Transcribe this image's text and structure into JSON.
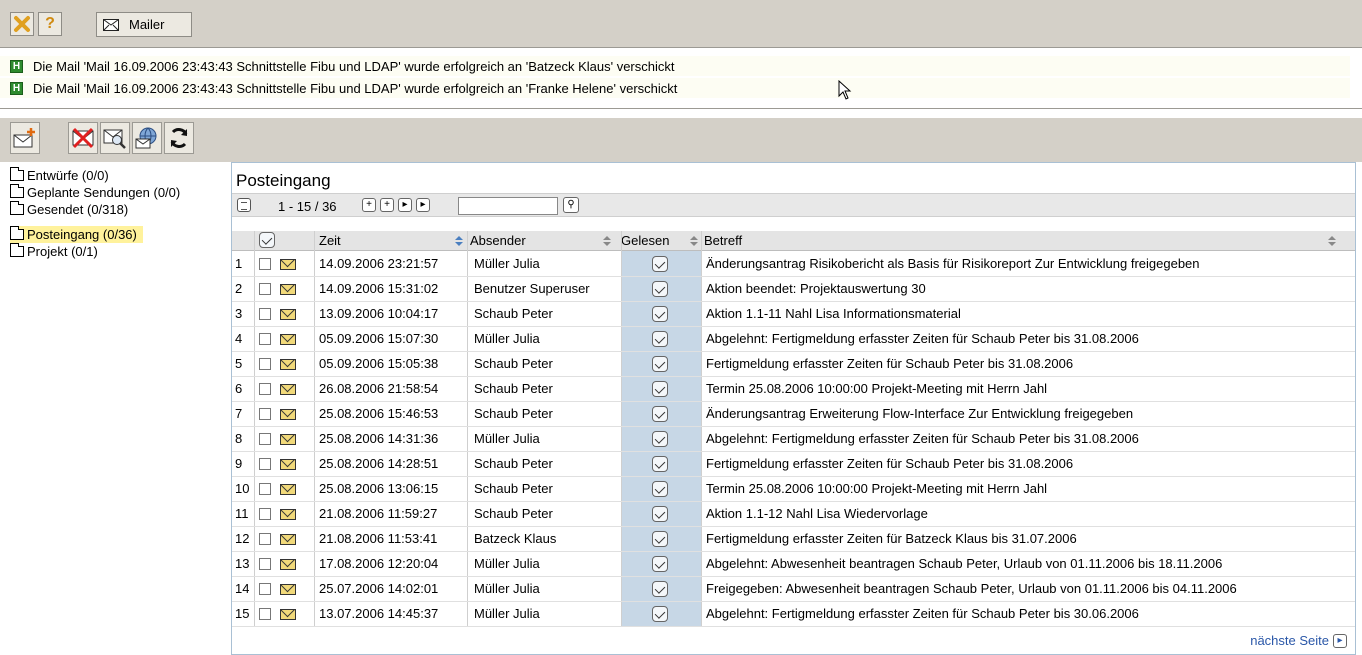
{
  "toolbar": {
    "mailer_label": "Mailer",
    "close_icon": "close-icon",
    "help_icon": "help-icon",
    "mail_icon": "envelope-icon",
    "help_glyph": "?"
  },
  "messages": [
    {
      "icon": "H",
      "text": "Die Mail 'Mail 16.09.2006 23:43:43 Schnittstelle Fibu und LDAP' wurde erfolgreich an 'Batzeck Klaus' verschickt"
    },
    {
      "icon": "H",
      "text": "Die Mail 'Mail 16.09.2006 23:43:43 Schnittstelle Fibu und LDAP' wurde erfolgreich an 'Franke Helene' verschickt"
    }
  ],
  "sidebar": {
    "folders": [
      {
        "label": "Entwürfe (0/0)",
        "selected": false
      },
      {
        "label": "Geplante Sendungen (0/0)",
        "selected": false
      },
      {
        "label": "Gesendet (0/318)",
        "selected": false
      },
      {
        "label": "Posteingang (0/36)",
        "selected": true
      },
      {
        "label": "Projekt (0/1)",
        "selected": false
      }
    ]
  },
  "main": {
    "title": "Posteingang",
    "pager": {
      "range": "1 - 15 / 36",
      "search_value": ""
    },
    "columns": {
      "time": "Zeit",
      "sender": "Absender",
      "read": "Gelesen",
      "subject": "Betreff"
    },
    "next_label": "nächste Seite",
    "rows": [
      {
        "n": "1",
        "time": "14.09.2006 23:21:57",
        "sender": "Müller Julia",
        "subject": "Änderungsantrag Risikobericht als Basis für Risikoreport Zur Entwicklung freigegeben"
      },
      {
        "n": "2",
        "time": "14.09.2006 15:31:02",
        "sender": "Benutzer Superuser",
        "subject": "Aktion beendet: Projektauswertung 30"
      },
      {
        "n": "3",
        "time": "13.09.2006 10:04:17",
        "sender": "Schaub Peter",
        "subject": "Aktion 1.1-11 Nahl Lisa Informationsmaterial"
      },
      {
        "n": "4",
        "time": "05.09.2006 15:07:30",
        "sender": "Müller Julia",
        "subject": "Abgelehnt: Fertigmeldung erfasster Zeiten für Schaub Peter bis 31.08.2006"
      },
      {
        "n": "5",
        "time": "05.09.2006 15:05:38",
        "sender": "Schaub Peter",
        "subject": "Fertigmeldung erfasster Zeiten für Schaub Peter bis 31.08.2006"
      },
      {
        "n": "6",
        "time": "26.08.2006 21:58:54",
        "sender": "Schaub Peter",
        "subject": "Termin 25.08.2006 10:00:00 Projekt-Meeting mit Herrn Jahl"
      },
      {
        "n": "7",
        "time": "25.08.2006 15:46:53",
        "sender": "Schaub Peter",
        "subject": "Änderungsantrag Erweiterung Flow-Interface Zur Entwicklung freigegeben"
      },
      {
        "n": "8",
        "time": "25.08.2006 14:31:36",
        "sender": "Müller Julia",
        "subject": "Abgelehnt: Fertigmeldung erfasster Zeiten für Schaub Peter bis 31.08.2006"
      },
      {
        "n": "9",
        "time": "25.08.2006 14:28:51",
        "sender": "Schaub Peter",
        "subject": "Fertigmeldung erfasster Zeiten für Schaub Peter bis 31.08.2006"
      },
      {
        "n": "10",
        "time": "25.08.2006 13:06:15",
        "sender": "Schaub Peter",
        "subject": "Termin 25.08.2006 10:00:00 Projekt-Meeting mit Herrn Jahl"
      },
      {
        "n": "11",
        "time": "21.08.2006 11:59:27",
        "sender": "Schaub Peter",
        "subject": "Aktion 1.1-12 Nahl Lisa Wiedervorlage"
      },
      {
        "n": "12",
        "time": "21.08.2006 11:53:41",
        "sender": "Batzeck Klaus",
        "subject": "Fertigmeldung erfasster Zeiten für Batzeck Klaus bis 31.07.2006"
      },
      {
        "n": "13",
        "time": "17.08.2006 12:20:04",
        "sender": "Müller Julia",
        "subject": "Abgelehnt: Abwesenheit beantragen Schaub Peter, Urlaub von 01.11.2006 bis 18.11.2006"
      },
      {
        "n": "14",
        "time": "25.07.2006 14:02:01",
        "sender": "Müller Julia",
        "subject": "Freigegeben: Abwesenheit beantragen Schaub Peter, Urlaub von 01.11.2006 bis 04.11.2006"
      },
      {
        "n": "15",
        "time": "13.07.2006 14:45:37",
        "sender": "Müller Julia",
        "subject": "Abgelehnt: Fertigmeldung erfasster Zeiten für Schaub Peter bis 30.06.2006"
      }
    ]
  }
}
